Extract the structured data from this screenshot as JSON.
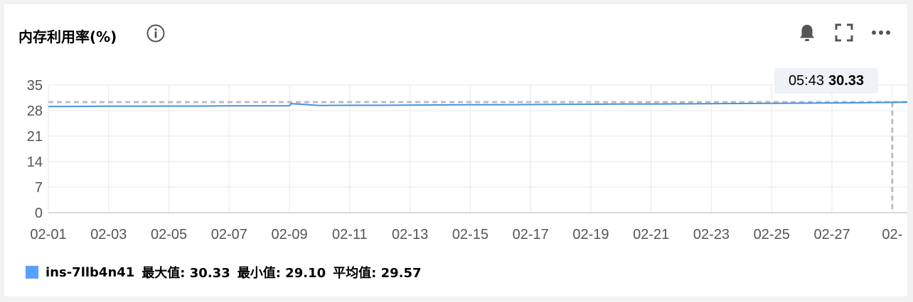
{
  "title": "内存利用率(%)",
  "icons": {
    "info": "info-circle-icon",
    "alarm": "bell-icon",
    "fullscreen": "fullscreen-icon",
    "more": "more-horizontal-icon"
  },
  "colors": {
    "series": "#4a90e2",
    "legend_swatch": "#5aa0ff",
    "grid": "#ececec",
    "axis": "#cfcfcf",
    "crosshair": "#bdbdbd"
  },
  "tooltip": {
    "time": "05:43",
    "value": "30.33"
  },
  "legend": {
    "name": "ins-7llb4n41",
    "max": "最大值: 30.33",
    "min": "最小值: 29.10",
    "avg": "平均值: 29.57"
  },
  "chart_data": {
    "type": "line",
    "title": "内存利用率(%)",
    "xlabel": "",
    "ylabel": "",
    "ylim": [
      0,
      35
    ],
    "yticks": [
      "0",
      "7",
      "14",
      "21",
      "28",
      "35"
    ],
    "xticks": [
      "02-01",
      "02-03",
      "02-05",
      "02-07",
      "02-09",
      "02-11",
      "02-13",
      "02-15",
      "02-17",
      "02-19",
      "02-21",
      "02-23",
      "02-25",
      "02-27",
      "02-"
    ],
    "x_days": [
      1,
      29.5
    ],
    "grid": true,
    "legend_position": "bottom-left",
    "series": [
      {
        "name": "ins-7llb4n41",
        "x": [
          1,
          2,
          3,
          4,
          5,
          6,
          7,
          8,
          9,
          9.05,
          10,
          11,
          12,
          13,
          14,
          15,
          16,
          17,
          18,
          19,
          20,
          21,
          22,
          23,
          24,
          25,
          26,
          27,
          28,
          29,
          29.5
        ],
        "values": [
          29.1,
          29.15,
          29.2,
          29.2,
          29.25,
          29.25,
          29.3,
          29.3,
          29.35,
          29.9,
          29.4,
          29.45,
          29.45,
          29.5,
          29.55,
          29.6,
          29.6,
          29.65,
          29.7,
          29.75,
          29.8,
          29.8,
          29.85,
          29.9,
          29.95,
          30.0,
          30.05,
          30.1,
          30.15,
          30.25,
          30.33
        ]
      }
    ],
    "reference_line": {
      "value": 30.33,
      "style": "dashed"
    },
    "cursor_x": 29.0
  }
}
